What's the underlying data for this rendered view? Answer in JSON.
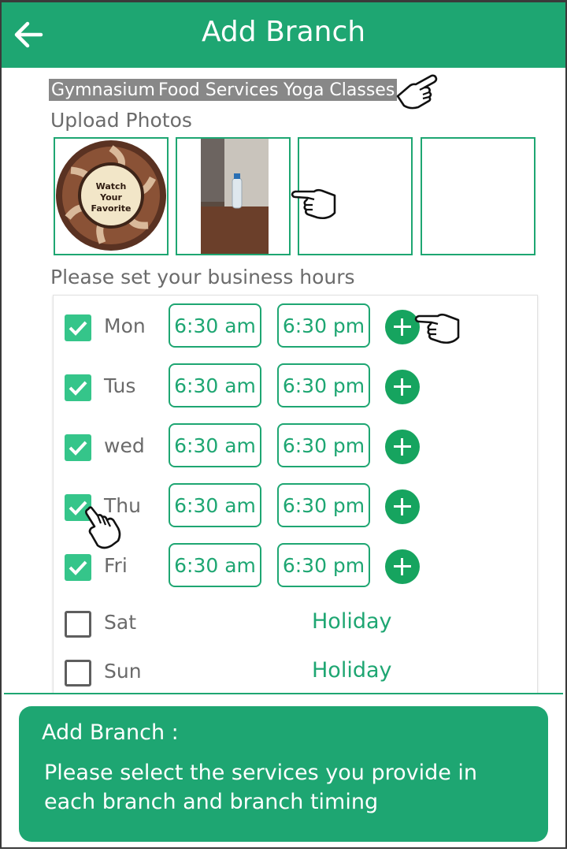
{
  "header": {
    "title": "Add Branch"
  },
  "services": [
    "Gymnasium",
    "Food Services",
    "Yoga Classes"
  ],
  "photos": {
    "label": "Upload Photos",
    "thumb1_text": [
      "Watch",
      "Your",
      "Favorite"
    ]
  },
  "hours": {
    "label": "Please set your business hours",
    "days": [
      {
        "day": "Mon",
        "checked": true,
        "open": "6:30 am",
        "close": "6:30 pm"
      },
      {
        "day": "Tus",
        "checked": true,
        "open": "6:30 am",
        "close": "6:30 pm"
      },
      {
        "day": "wed",
        "checked": true,
        "open": "6:30 am",
        "close": "6:30 pm"
      },
      {
        "day": "Thu",
        "checked": true,
        "open": "6:30 am",
        "close": "6:30 pm"
      },
      {
        "day": "Fri",
        "checked": true,
        "open": "6:30 am",
        "close": "6:30 pm"
      },
      {
        "day": "Sat",
        "checked": false,
        "status": "Holiday"
      },
      {
        "day": "Sun",
        "checked": false,
        "status": "Holiday"
      }
    ]
  },
  "tooltip": {
    "title": "Add Branch :",
    "body": "Please select the services you provide in each branch and branch timing"
  },
  "colors": {
    "primary": "#1ea672",
    "checkbox": "#35c58a",
    "chip": "#888888"
  }
}
